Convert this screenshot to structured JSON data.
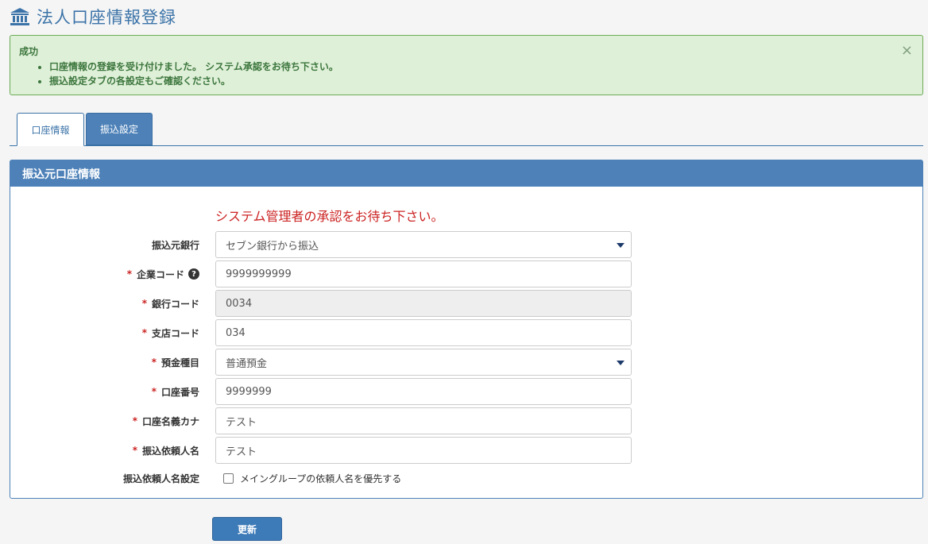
{
  "page": {
    "title": "法人口座情報登録",
    "icon": "bank-icon"
  },
  "alert": {
    "title": "成功",
    "messages": [
      "口座情報の登録を受け付けました。 システム承認をお待ち下さい。",
      "振込設定タブの各設定もご確認ください。"
    ],
    "close": "×"
  },
  "tabs": [
    {
      "label": "口座情報",
      "active": true
    },
    {
      "label": "振込設定",
      "active": false
    }
  ],
  "panel": {
    "heading": "振込元口座情報",
    "notice": "システム管理者の承認をお待ち下さい。",
    "required_mark": "*",
    "help_symbol": "?",
    "fields": {
      "bank_source": {
        "label": "振込元銀行",
        "value": "セブン銀行から振込"
      },
      "company_code": {
        "label": "企業コード",
        "value": "9999999999"
      },
      "bank_code": {
        "label": "銀行コード",
        "value": "0034"
      },
      "branch_code": {
        "label": "支店コード",
        "value": "034"
      },
      "deposit_type": {
        "label": "預金種目",
        "value": "普通預金"
      },
      "account_number": {
        "label": "口座番号",
        "value": "9999999"
      },
      "account_name_kana": {
        "label": "口座名義カナ",
        "value": "テスト"
      },
      "requester_name": {
        "label": "振込依頼人名",
        "value": "テスト"
      },
      "requester_setting": {
        "label": "振込依頼人名設定",
        "checkbox_label": "メイングループの依頼人名を優先する",
        "checked": false
      }
    }
  },
  "submit_label": "更新",
  "colors": {
    "primary": "#4d81b8",
    "success_bg": "#dff0d8",
    "required": "#cc2222"
  }
}
